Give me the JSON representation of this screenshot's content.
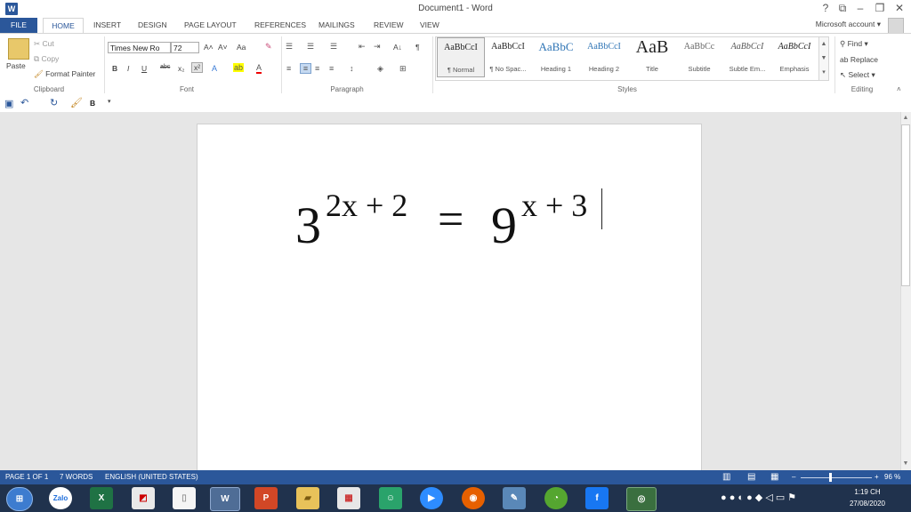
{
  "window": {
    "title": "Document1 - Word",
    "app_logo": "W",
    "controls": {
      "help": "?",
      "ribbon_options": "⧉",
      "minimize": "–",
      "restore": "❐",
      "close": "✕"
    }
  },
  "tabs": [
    "FILE",
    "HOME",
    "INSERT",
    "DESIGN",
    "PAGE LAYOUT",
    "REFERENCES",
    "MAILINGS",
    "REVIEW",
    "VIEW"
  ],
  "account": {
    "label": "Microsoft account ▾"
  },
  "clipboard": {
    "paste": "Paste",
    "cut": "Cut",
    "copy": "Copy",
    "format_painter": "Format Painter",
    "label": "Clipboard"
  },
  "font": {
    "name": "Times New Ro",
    "size": "72",
    "label": "Font",
    "bold": "B",
    "italic": "I",
    "underline": "U",
    "strike": "abc",
    "subscript": "x₂",
    "superscript": "x²",
    "grow": "A˄",
    "shrink": "A˅",
    "case": "Aa"
  },
  "paragraph": {
    "label": "Paragraph",
    "pilcrow": "¶",
    "sort": "A↓"
  },
  "styles": {
    "label": "Styles",
    "items": [
      {
        "sample": "AaBbCcI",
        "name": "¶ Normal"
      },
      {
        "sample": "AaBbCcI",
        "name": "¶ No Spac..."
      },
      {
        "sample": "AaBbC",
        "name": "Heading 1"
      },
      {
        "sample": "AaBbCcI",
        "name": "Heading 2"
      },
      {
        "sample": "AaB",
        "name": "Title"
      },
      {
        "sample": "AaBbCc",
        "name": "Subtitle"
      },
      {
        "sample": "AaBbCcI",
        "name": "Subtle Em..."
      },
      {
        "sample": "AaBbCcI",
        "name": "Emphasis"
      }
    ]
  },
  "editing": {
    "find": "Find",
    "replace": "Replace",
    "select": "Select",
    "label": "Editing"
  },
  "qat": {
    "bold": "B"
  },
  "document": {
    "eq_base1": "3",
    "eq_exp1": "2x + 2",
    "eq_equals": "=",
    "eq_base2": "9",
    "eq_exp2": "x + 3"
  },
  "status": {
    "page": "PAGE 1 OF 1",
    "words": "7 WORDS",
    "language": "ENGLISH (UNITED STATES)",
    "zoom": "96 %"
  },
  "taskbar": {
    "apps": [
      "Zalo"
    ],
    "time": "1:19 CH",
    "date": "27/08/2020"
  },
  "colors": {
    "word_blue": "#2b579a",
    "taskbar": "#20324d"
  }
}
